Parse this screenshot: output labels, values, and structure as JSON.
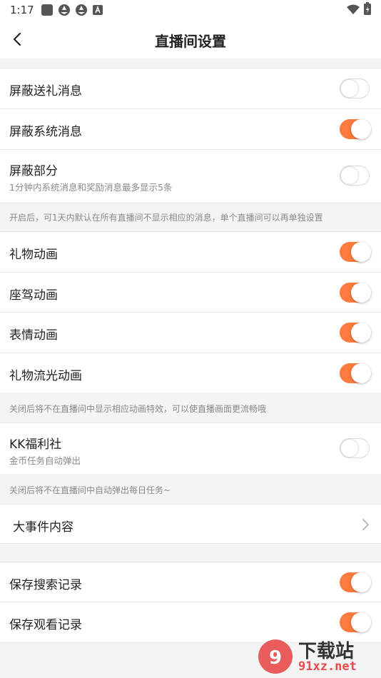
{
  "status_bar": {
    "time": "1:17"
  },
  "header": {
    "title": "直播间设置"
  },
  "rows": {
    "block_gift": {
      "label": "屏蔽送礼消息",
      "enabled": false
    },
    "block_system": {
      "label": "屏蔽系统消息",
      "enabled": true
    },
    "block_partial": {
      "label": "屏蔽部分",
      "sub": "1分钟内系统消息和奖励消息最多显示5条",
      "enabled": false
    },
    "gift_animation": {
      "label": "礼物动画",
      "enabled": true
    },
    "mount_animation": {
      "label": "座驾动画",
      "enabled": true
    },
    "emoji_animation": {
      "label": "表情动画",
      "enabled": true
    },
    "gift_shine_animation": {
      "label": "礼物流光动画",
      "enabled": true
    },
    "kk_welfare": {
      "label": "KK福利社",
      "sub": "金币任务自动弹出",
      "enabled": false
    },
    "big_events": {
      "label": "大事件内容"
    },
    "save_search": {
      "label": "保存搜索记录",
      "enabled": true
    },
    "save_watch": {
      "label": "保存观看记录",
      "enabled": true
    }
  },
  "notes": {
    "block_note": "开启后，可1天内默认在所有直播间不显示相应的消息，单个直播间可以再单独设置",
    "animation_note": "关闭后将不在直播间中显示相应动画特效，可以使直播画面更流畅哦",
    "welfare_note": "关闭后将不在直播间中自动弹出每日任务~"
  },
  "watermark": {
    "brand_text": "下载站",
    "domain_text": "91xz.net"
  },
  "colors": {
    "accent": "#ff7a3d",
    "background": "#f4f4f4"
  }
}
